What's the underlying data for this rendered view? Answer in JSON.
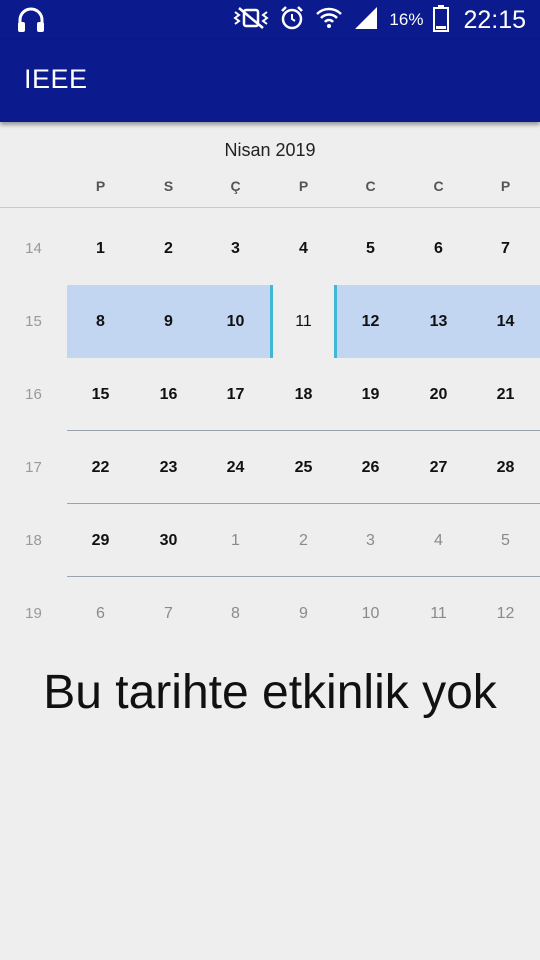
{
  "status_bar": {
    "battery_percent": "16%",
    "time": "22:15",
    "icons": [
      "headphones-icon",
      "vibrate-mute-icon",
      "alarm-icon",
      "wifi-icon",
      "signal-icon",
      "battery-icon"
    ]
  },
  "app_bar": {
    "title": "IEEE",
    "color": "#0b1a8c"
  },
  "calendar": {
    "month_title": "Nisan 2019",
    "weekday_labels": [
      "P",
      "S",
      "Ç",
      "P",
      "C",
      "C",
      "P"
    ],
    "weeks": [
      {
        "week_number": "14",
        "days": [
          "1",
          "2",
          "3",
          "4",
          "5",
          "6",
          "7"
        ]
      },
      {
        "week_number": "15",
        "days": [
          "8",
          "9",
          "10",
          "11",
          "12",
          "13",
          "14"
        ]
      },
      {
        "week_number": "16",
        "days": [
          "15",
          "16",
          "17",
          "18",
          "19",
          "20",
          "21"
        ]
      },
      {
        "week_number": "17",
        "days": [
          "22",
          "23",
          "24",
          "25",
          "26",
          "27",
          "28"
        ]
      },
      {
        "week_number": "18",
        "days": [
          "29",
          "30",
          "1",
          "2",
          "3",
          "4",
          "5"
        ]
      },
      {
        "week_number": "19",
        "days": [
          "6",
          "7",
          "8",
          "9",
          "10",
          "11",
          "12"
        ]
      }
    ],
    "selected_date": "11",
    "selected_week": "15",
    "highlight_color": "#c2d5f1",
    "selection_border_color": "#3fb7d8"
  },
  "empty_message": "Bu tarihte etkinlik yok"
}
